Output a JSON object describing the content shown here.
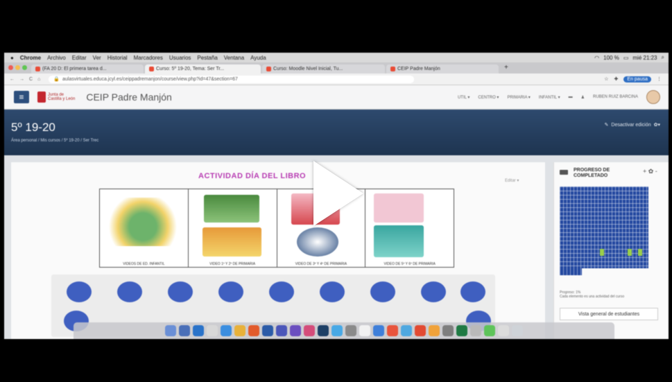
{
  "menubar": {
    "items": [
      "Chrome",
      "Archivo",
      "Editar",
      "Ver",
      "Historial",
      "Marcadores",
      "Usuarios",
      "Pestaña",
      "Ventana",
      "Ayuda"
    ],
    "battery": "100 %",
    "clock": "mié 21:23"
  },
  "tabs": [
    {
      "label": "(FA 20 D: El primera tarea d..."
    },
    {
      "label": "Curso: 5º 19-20, Tema: Ser Tr..."
    },
    {
      "label": "Curso: Moodle Nivel Inicial, Tu..."
    },
    {
      "label": "CEIP Padre Manjón"
    }
  ],
  "address": {
    "url": "aulasvirtuales.educa.jcyl.es/ceippadremanjon/course/view.php?id=47&section=67",
    "pill": "En pausa"
  },
  "moodle": {
    "logo_line1": "Junta de",
    "logo_line2": "Castilla y León",
    "site_name": "CEIP Padre Manjón",
    "menus": [
      "UTIL ▾",
      "CENTRO ▾",
      "PRIMARIA ▾",
      "INFANTIL ▾"
    ],
    "user": "RUBEN RUIZ BARCINA"
  },
  "course": {
    "title": "5º 19-20",
    "breadcrumb": "Área personal / Mis cursos / 5º 19-20 / Ser Trec",
    "edit_label": "Desactivar edición"
  },
  "activity": {
    "title": "ACTIVIDAD DÍA DEL LIBRO",
    "edit_link": "Editar ▾",
    "captions": [
      "VÍDEOS DE ED. INFANTIL",
      "VÍDEO 1º Y 2º DE PRIMARIA",
      "VÍDEO DE 3º Y 4º DE PRIMARIA",
      "VÍDEO DE 5º Y 6º DE PRIMARIA"
    ]
  },
  "sideblock": {
    "title": "PROGRESO DE COMPLETADO",
    "controls": "+ ✿ -",
    "small_text": "Progreso: 1%",
    "small_text2": "Cada elemento es una actividad del curso",
    "overview_button": "Vista general de estudiantes"
  },
  "player": {
    "play_icon": "play-icon"
  }
}
